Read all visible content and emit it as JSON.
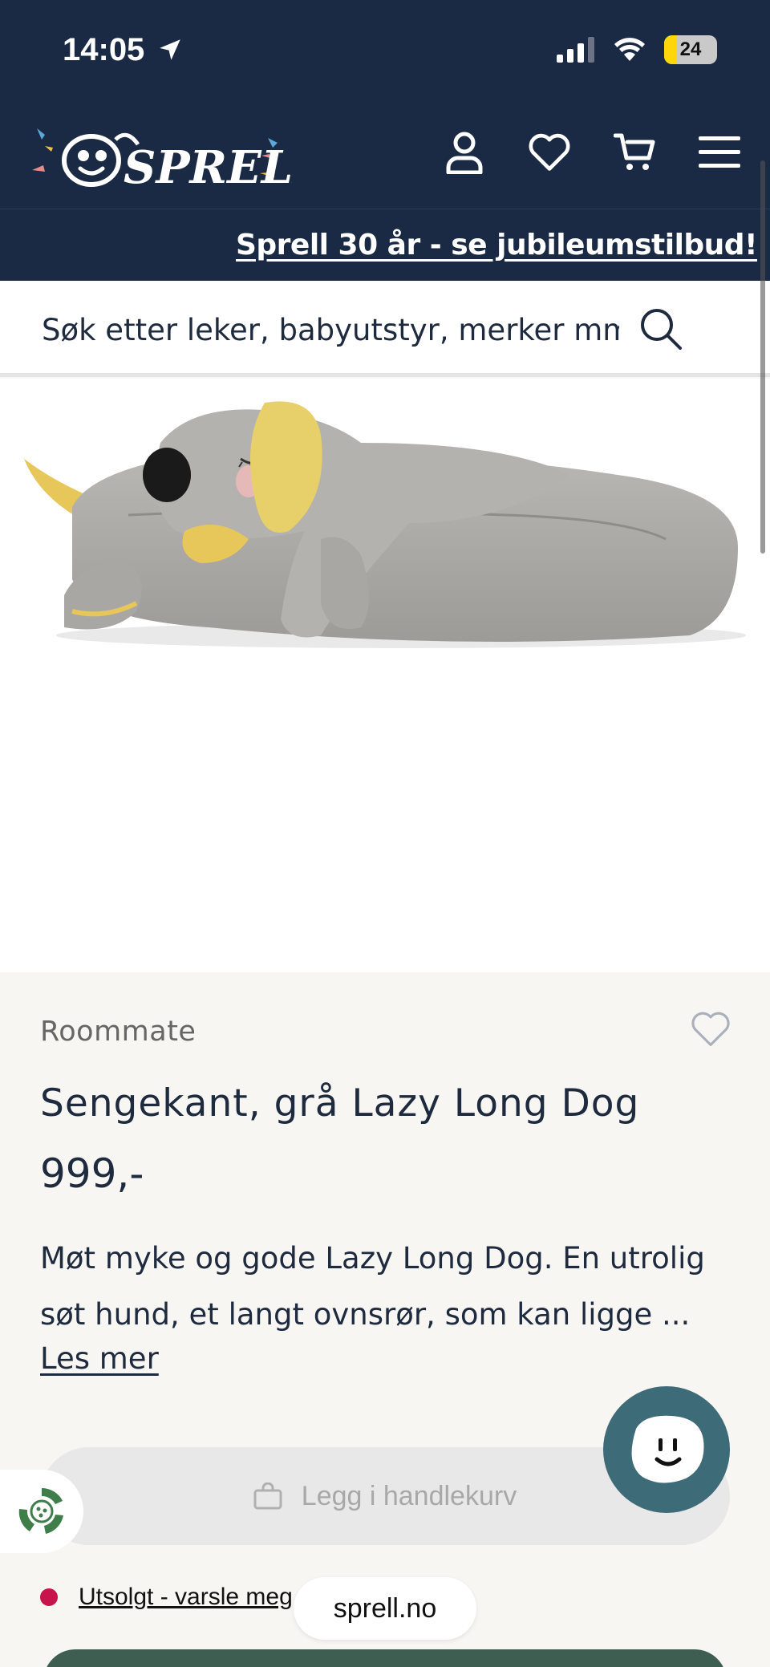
{
  "status_bar": {
    "time": "14:05",
    "battery": "24",
    "battery_level_percent": 24,
    "icons": [
      "location-arrow-icon",
      "cellular-signal-icon",
      "wifi-icon",
      "battery-icon"
    ]
  },
  "header": {
    "logo_text": "SPRELL",
    "icons": [
      "user-icon",
      "heart-icon",
      "cart-icon",
      "menu-icon"
    ]
  },
  "promo": {
    "text": "Sprell 30 år - se jubileumstilbud!"
  },
  "search": {
    "placeholder": "Søk etter leker, babyutstyr, merker mm"
  },
  "product": {
    "brand": "Roommate",
    "title": "Sengekant, grå Lazy Long Dog",
    "price": "999,-",
    "description": "Møt myke og gode Lazy Long Dog. En utrolig søt hund, et langt ovnsrør, som kan ligge ...",
    "read_more": "Les mer"
  },
  "actions": {
    "add_to_cart": "Legg i handlekurv",
    "sold_out": "Utsolgt - varsle meg",
    "url": "sprell.no"
  },
  "colors": {
    "navy": "#1b2a44",
    "chat_teal": "#3e6b78",
    "sold_out_dot": "#c8134c",
    "bottom_button": "#3f5e52"
  }
}
